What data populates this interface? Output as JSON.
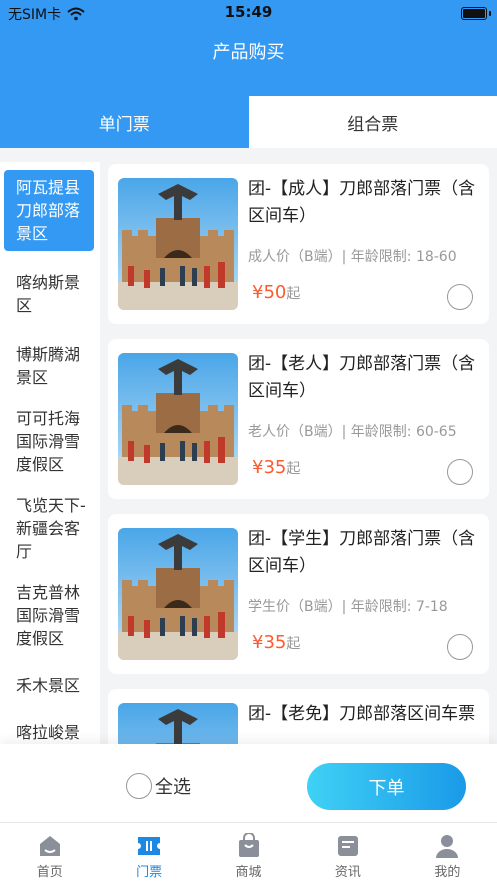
{
  "status_bar": {
    "carrier": "无SIM卡",
    "time": "15:49"
  },
  "header": {
    "title": "产品购买"
  },
  "tabs": [
    {
      "label": "单门票",
      "active": true
    },
    {
      "label": "组合票",
      "active": false
    }
  ],
  "sidebar": {
    "items": [
      {
        "label": "阿瓦提县刀郎部落景区",
        "active": true
      },
      {
        "label": "喀纳斯景区"
      },
      {
        "label": "博斯腾湖景区"
      },
      {
        "label": "可可托海国际滑雪度假区"
      },
      {
        "label": "飞览天下-新疆会客厅"
      },
      {
        "label": "吉克普林国际滑雪度假区"
      },
      {
        "label": "禾木景区"
      },
      {
        "label": "喀拉峻景区"
      }
    ]
  },
  "products": [
    {
      "title": "团-【成人】刀郎部落门票（含区间车）",
      "sub": "成人价（B端）| 年龄限制: 18-60",
      "price": "¥50",
      "price_suffix": "起"
    },
    {
      "title": "团-【老人】刀郎部落门票（含区间车）",
      "sub": "老人价（B端）| 年龄限制: 60-65",
      "price": "¥35",
      "price_suffix": "起"
    },
    {
      "title": "团-【学生】刀郎部落门票（含区间车）",
      "sub": "学生价（B端）| 年龄限制: 7-18",
      "price": "¥35",
      "price_suffix": "起"
    },
    {
      "title": "团-【老免】刀郎部落区间车票",
      "sub": "",
      "price": "",
      "price_suffix": ""
    }
  ],
  "bottom_bar": {
    "select_all": "全选",
    "order_button": "下单"
  },
  "tabbar": {
    "items": [
      {
        "label": "首页",
        "icon": "home-icon"
      },
      {
        "label": "门票",
        "icon": "ticket-icon",
        "active": true
      },
      {
        "label": "商城",
        "icon": "shop-bag-icon"
      },
      {
        "label": "资讯",
        "icon": "news-icon"
      },
      {
        "label": "我的",
        "icon": "user-icon"
      }
    ]
  },
  "colors": {
    "primary": "#3399f3",
    "price": "#ff5a2e",
    "tab_active": "#1e88e5"
  }
}
